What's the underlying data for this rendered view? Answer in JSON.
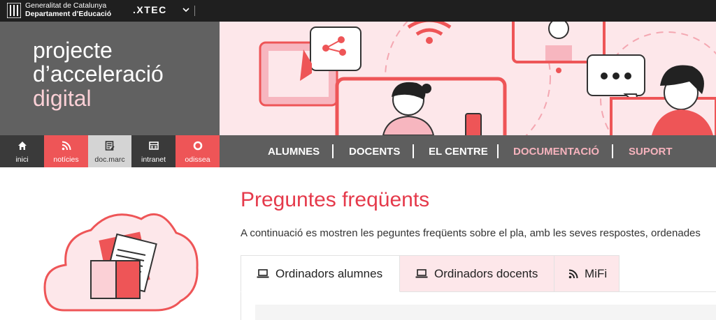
{
  "topbar": {
    "org_line1": "Generalitat de Catalunya",
    "org_line2": "Departament d’Educació",
    "xtec_label": ".XTEC"
  },
  "header": {
    "title_line1": "projecte",
    "title_line2": "d’acceleració",
    "title_line3": "digital"
  },
  "icon_nav": [
    {
      "label": "inici",
      "icon": "home-icon"
    },
    {
      "label": "notícies",
      "icon": "rss-icon"
    },
    {
      "label": "doc.marc",
      "icon": "document-edit-icon"
    },
    {
      "label": "intranet",
      "icon": "intranet-icon"
    },
    {
      "label": "odissea",
      "icon": "odissea-ring-icon"
    }
  ],
  "main_menu": [
    "ALUMNES",
    "DOCENTS",
    "EL CENTRE",
    "DOCUMENTACIÓ",
    "SUPORT"
  ],
  "content": {
    "title": "Preguntes freqüents",
    "intro": "A continuació es mostren les peguntes freqüents sobre el pla, amb les seves respostes, ordenades"
  },
  "tabs": [
    {
      "label": "Ordinadors alumnes",
      "icon": "laptop-icon"
    },
    {
      "label": "Ordinadors docents",
      "icon": "laptop-icon"
    },
    {
      "label": "MiFi",
      "icon": "wifi-signal-icon"
    }
  ],
  "colors": {
    "accent_red": "#ee5557",
    "title_red": "#e53a4b",
    "pink_text": "#f6b3bd",
    "pink_bg": "#fde7ea",
    "dark_gray": "#616161"
  }
}
